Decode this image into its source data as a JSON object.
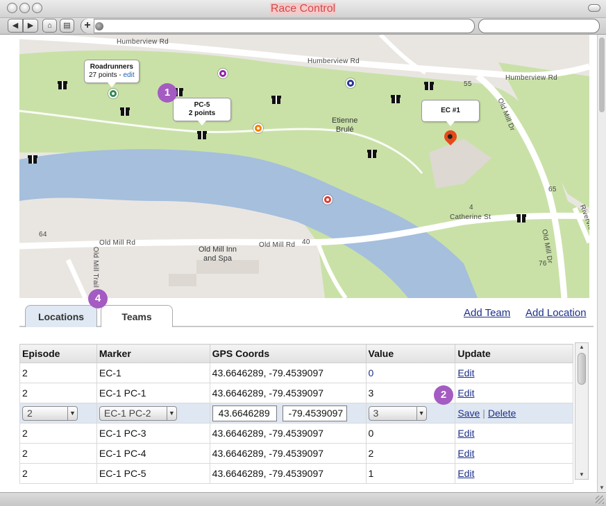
{
  "window": {
    "title": "Race Control"
  },
  "map": {
    "roads": [
      "Humberview Rd",
      "Humberview Rd",
      "Humberview Rd",
      "Old Mill Dr",
      "Old Mill Dr",
      "Old Mill Rd",
      "Old Mill Rd",
      "Catherine St",
      "Old Mill Trail",
      "Riverview"
    ],
    "places": {
      "etienne": "Etienne\nBrulé",
      "old_mill_inn": "Old Mill Inn\nand Spa"
    },
    "numbers": [
      "55",
      "65",
      "64",
      "40",
      "4",
      "76"
    ],
    "callouts": {
      "roadrunners": {
        "name": "Roadrunners",
        "points": "27 points -",
        "edit": "edit"
      },
      "pc5": {
        "name": "PC-5",
        "points": "2 points"
      },
      "ec1": {
        "name": "EC #1"
      }
    },
    "marker_colors": {
      "green": "#2e8b57",
      "purple": "#8e24aa",
      "blue": "#283593",
      "orange": "#f57c00",
      "red": "#e53935",
      "pin": "#e64a19"
    }
  },
  "annotations": {
    "badge1": "1",
    "badge2": "2",
    "badge4": "4"
  },
  "tabs": {
    "locations": "Locations",
    "teams": "Teams"
  },
  "links": {
    "add_team": "Add Team",
    "add_location": "Add Location"
  },
  "table": {
    "headers": [
      "Episode",
      "Marker",
      "GPS Coords",
      "Value",
      "Update"
    ],
    "rows": [
      {
        "episode": "2",
        "marker": "EC-1",
        "gps": "43.6646289, -79.4539097",
        "value": "0",
        "action": "Edit"
      },
      {
        "episode": "2",
        "marker": "EC-1 PC-1",
        "gps": "43.6646289, -79.4539097",
        "value": "3",
        "action": "Edit"
      },
      {
        "episode": "2",
        "marker": "EC-1 PC-2",
        "lat": "43.6646289",
        "lng": "-79.4539097",
        "value": "3",
        "save": "Save",
        "delete": "Delete"
      },
      {
        "episode": "2",
        "marker": "EC-1 PC-3",
        "gps": "43.6646289, -79.4539097",
        "value": "0",
        "action": "Edit"
      },
      {
        "episode": "2",
        "marker": "EC-1 PC-4",
        "gps": "43.6646289, -79.4539097",
        "value": "2",
        "action": "Edit"
      },
      {
        "episode": "2",
        "marker": "EC-1 PC-5",
        "gps": "43.6646289, -79.4539097",
        "value": "1",
        "action": "Edit"
      }
    ]
  }
}
